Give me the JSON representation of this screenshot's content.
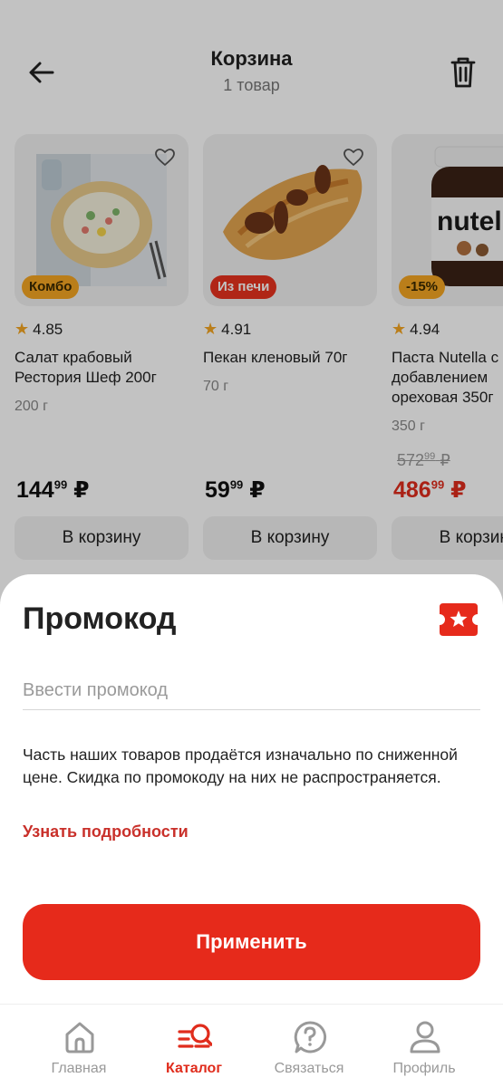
{
  "header": {
    "title": "Корзина",
    "subtitle": "1 товар"
  },
  "products": [
    {
      "badge": "Комбо",
      "rating": "4.85",
      "name": "Салат крабовый Рестория Шеф 200г",
      "weight": "200 г",
      "price_main": "144",
      "price_cents": "99",
      "currency": "₽",
      "cart_label": "В корзину"
    },
    {
      "badge": "Из печи",
      "rating": "4.91",
      "name": "Пекан кленовый 70г",
      "weight": "70 г",
      "price_main": "59",
      "price_cents": "99",
      "currency": "₽",
      "cart_label": "В корзину"
    },
    {
      "badge": "-15%",
      "rating": "4.94",
      "name": "Паста Nutella с добавлением ореховая 350г",
      "weight": "350 г",
      "old_price_main": "572",
      "old_price_cents": "99",
      "price_main": "486",
      "price_cents": "99",
      "currency": "₽",
      "cart_label": "В корзину",
      "image_brand_text": "nutella"
    }
  ],
  "promo_sheet": {
    "title": "Промокод",
    "input_placeholder": "Ввести промокод",
    "note": "Часть наших товаров продаётся изначально по сниженной цене. Скидка по промокоду на них не распространяется.",
    "link_label": "Узнать подробности",
    "apply_label": "Применить"
  },
  "tabbar": {
    "items": [
      {
        "label": "Главная",
        "icon": "home-icon"
      },
      {
        "label": "Каталог",
        "icon": "catalog-search-icon"
      },
      {
        "label": "Связаться",
        "icon": "help-chat-icon"
      },
      {
        "label": "Профиль",
        "icon": "profile-icon"
      }
    ],
    "active_index": 1
  },
  "colors": {
    "accent": "#e62a1b",
    "link": "#c9302a",
    "badge_yellow": "#f5a623",
    "card_bg": "#f1f1f1"
  }
}
